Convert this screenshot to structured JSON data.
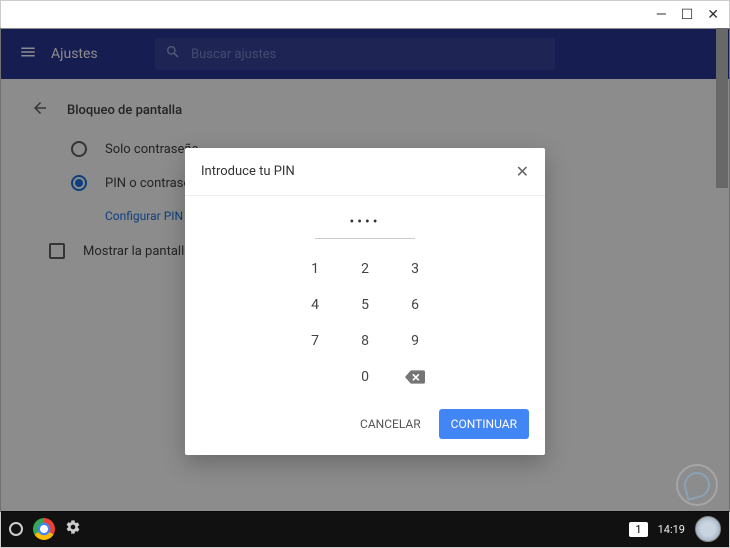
{
  "titlebar": {
    "minimize": "—",
    "maximize": "☐",
    "close": "✕"
  },
  "header": {
    "title": "Ajustes",
    "search_placeholder": "Buscar ajustes"
  },
  "page": {
    "title": "Bloqueo de pantalla",
    "options": [
      {
        "label": "Solo contraseña",
        "selected": false
      },
      {
        "label": "PIN o contraseña",
        "selected": true
      }
    ],
    "configure_link": "Configurar PIN",
    "checkbox_label": "Mostrar la pantalla de bloqueo"
  },
  "dialog": {
    "title": "Introduce tu PIN",
    "pin_value": "••••",
    "keys": [
      "1",
      "2",
      "3",
      "4",
      "5",
      "6",
      "7",
      "8",
      "9",
      "",
      "0",
      ""
    ],
    "cancel": "CANCELAR",
    "continue": "CONTINUAR"
  },
  "shelf": {
    "notification_count": "1",
    "time": "14:19"
  }
}
